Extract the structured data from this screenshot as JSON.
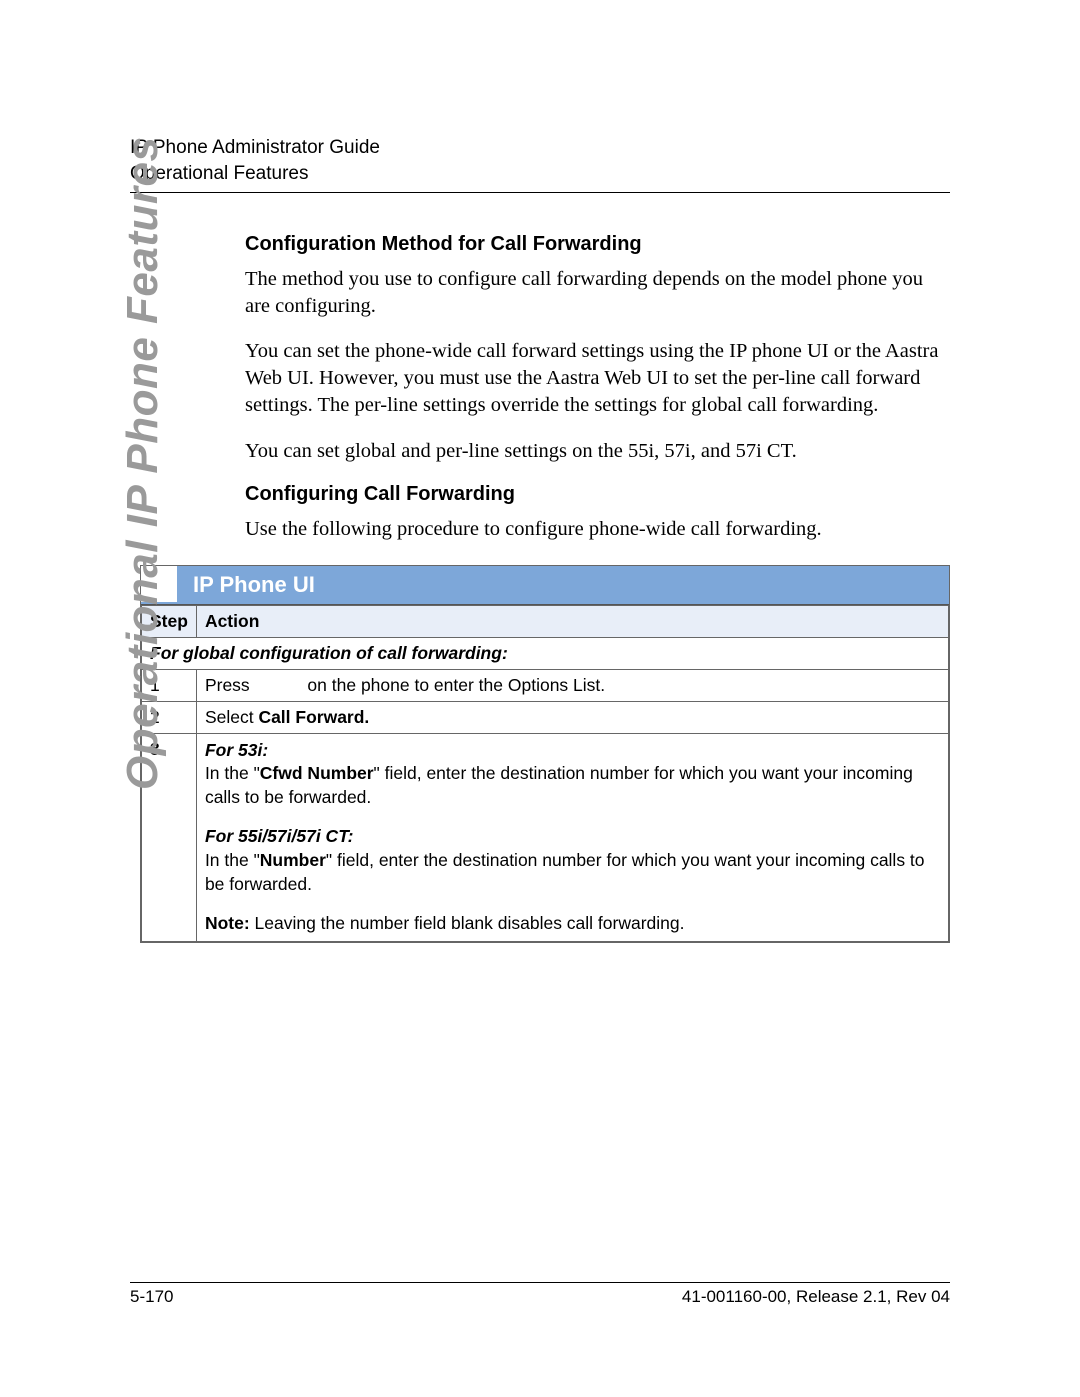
{
  "header": {
    "line1": "IP Phone Administrator Guide",
    "line2": "Operational Features"
  },
  "side_tab": "Operational IP Phone Features",
  "sections": {
    "config_method_title": "Configuration Method for Call Forwarding",
    "config_method_p1": "The method you use to configure call forwarding depends on the model phone you are configuring.",
    "config_method_p2": "You can set the phone-wide call forward settings using the IP phone UI or the Aastra Web UI. However, you must use the Aastra Web UI to set the per-line call forward settings. The per-line settings override the settings for global call forwarding.",
    "config_method_p3": "You can set global and per-line settings on the 55i, 57i, and 57i CT.",
    "config_call_fwd_title": "Configuring Call Forwarding",
    "config_call_fwd_p1": "Use the following procedure to configure phone-wide call forwarding."
  },
  "procedure": {
    "title": "IP Phone UI",
    "columns": {
      "step": "Step",
      "action": "Action"
    },
    "subheader": "For global configuration of call forwarding:",
    "rows": {
      "r1": {
        "step": "1",
        "action_prefix": "Press",
        "action_suffix": "on the phone to enter the Options List."
      },
      "r2": {
        "step": "2",
        "action_pre": "Select ",
        "action_bold": "Call Forward.",
        "action_post": ""
      },
      "r3": {
        "step": "3",
        "model1": "For 53i:",
        "line1a": "In the \"",
        "line1b": "Cfwd Number",
        "line1c": "\" field, enter the destination number for which you want your incoming calls to be forwarded.",
        "model2": "For 55i/57i/57i CT:",
        "line2a": "In the \"",
        "line2b": "Number",
        "line2c": "\" field, enter the destination number for which you want your incoming calls to be forwarded.",
        "note_label": "Note:",
        "note_text": " Leaving the number field blank disables call forwarding."
      }
    }
  },
  "footer": {
    "left": "5-170",
    "right": "41-001160-00, Release 2.1, Rev 04"
  }
}
